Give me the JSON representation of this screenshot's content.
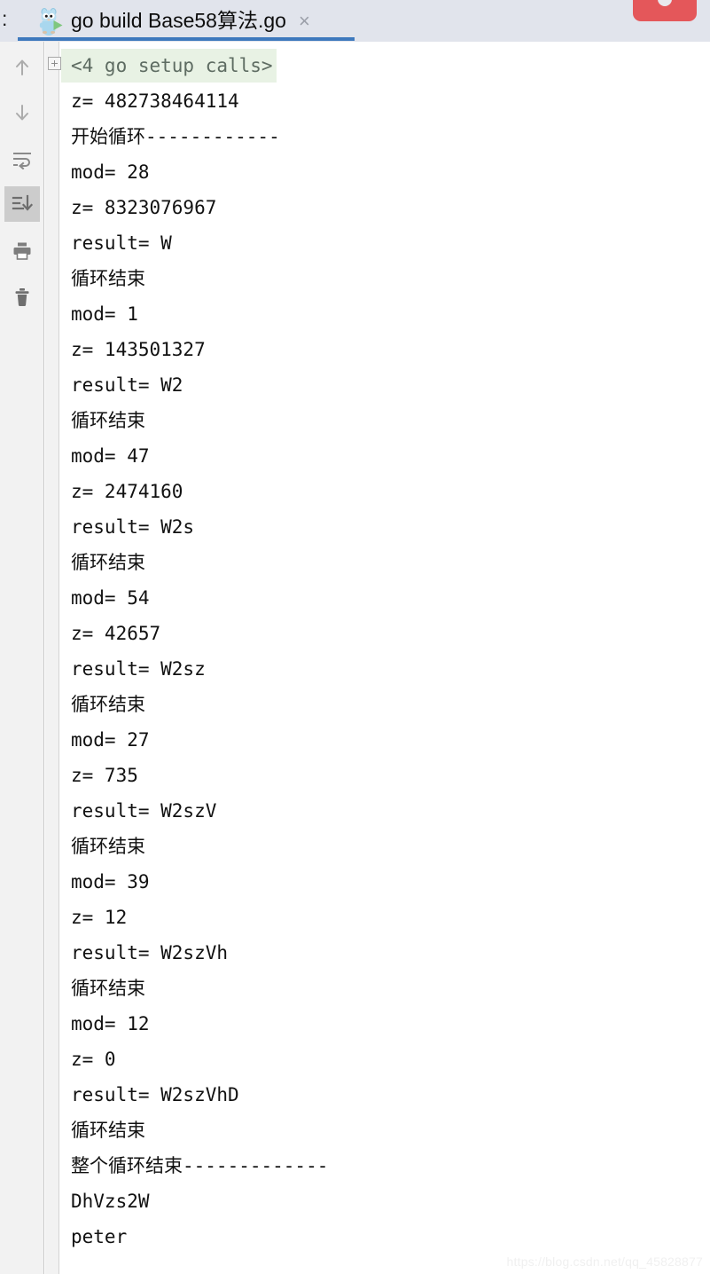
{
  "window": {
    "prefix_label": ":",
    "stop_button_label": "",
    "accent_blue": "#3e79bd",
    "stop_red": "#e4575a",
    "tabbar_bg": "#e1e4ec",
    "toolbar_bg": "#f2f2f2",
    "fold_bg": "#e8f2e4"
  },
  "tab": {
    "icon": "go-gopher-run-icon",
    "title": "go build Base58算法.go",
    "close_label": "×"
  },
  "toolbar": {
    "items": [
      {
        "name": "up-arrow-icon",
        "label": "Up the Stack Trace",
        "active": false
      },
      {
        "name": "down-arrow-icon",
        "label": "Down the Stack Trace",
        "active": false
      },
      {
        "name": "soft-wrap-icon",
        "label": "Soft-Wrap",
        "active": false
      },
      {
        "name": "scroll-to-end-icon",
        "label": "Scroll to the End",
        "active": true
      },
      {
        "name": "print-icon",
        "label": "Print",
        "active": false
      },
      {
        "name": "trash-icon",
        "label": "Clear All",
        "active": false
      }
    ]
  },
  "console": {
    "fold_toggle": "expand-fold-icon",
    "folded_line": "<4 go setup calls>",
    "lines": [
      "z= 482738464114",
      "开始循环------------",
      "mod= 28",
      "z= 8323076967",
      "result= W",
      "循环结束",
      "mod= 1",
      "z= 143501327",
      "result= W2",
      "循环结束",
      "mod= 47",
      "z= 2474160",
      "result= W2s",
      "循环结束",
      "mod= 54",
      "z= 42657",
      "result= W2sz",
      "循环结束",
      "mod= 27",
      "z= 735",
      "result= W2szV",
      "循环结束",
      "mod= 39",
      "z= 12",
      "result= W2szVh",
      "循环结束",
      "mod= 12",
      "z= 0",
      "result= W2szVhD",
      "循环结束",
      "整个循环结束-------------",
      "DhVzs2W",
      "peter"
    ]
  },
  "watermark": {
    "text": "https://blog.csdn.net/qq_45828877"
  }
}
